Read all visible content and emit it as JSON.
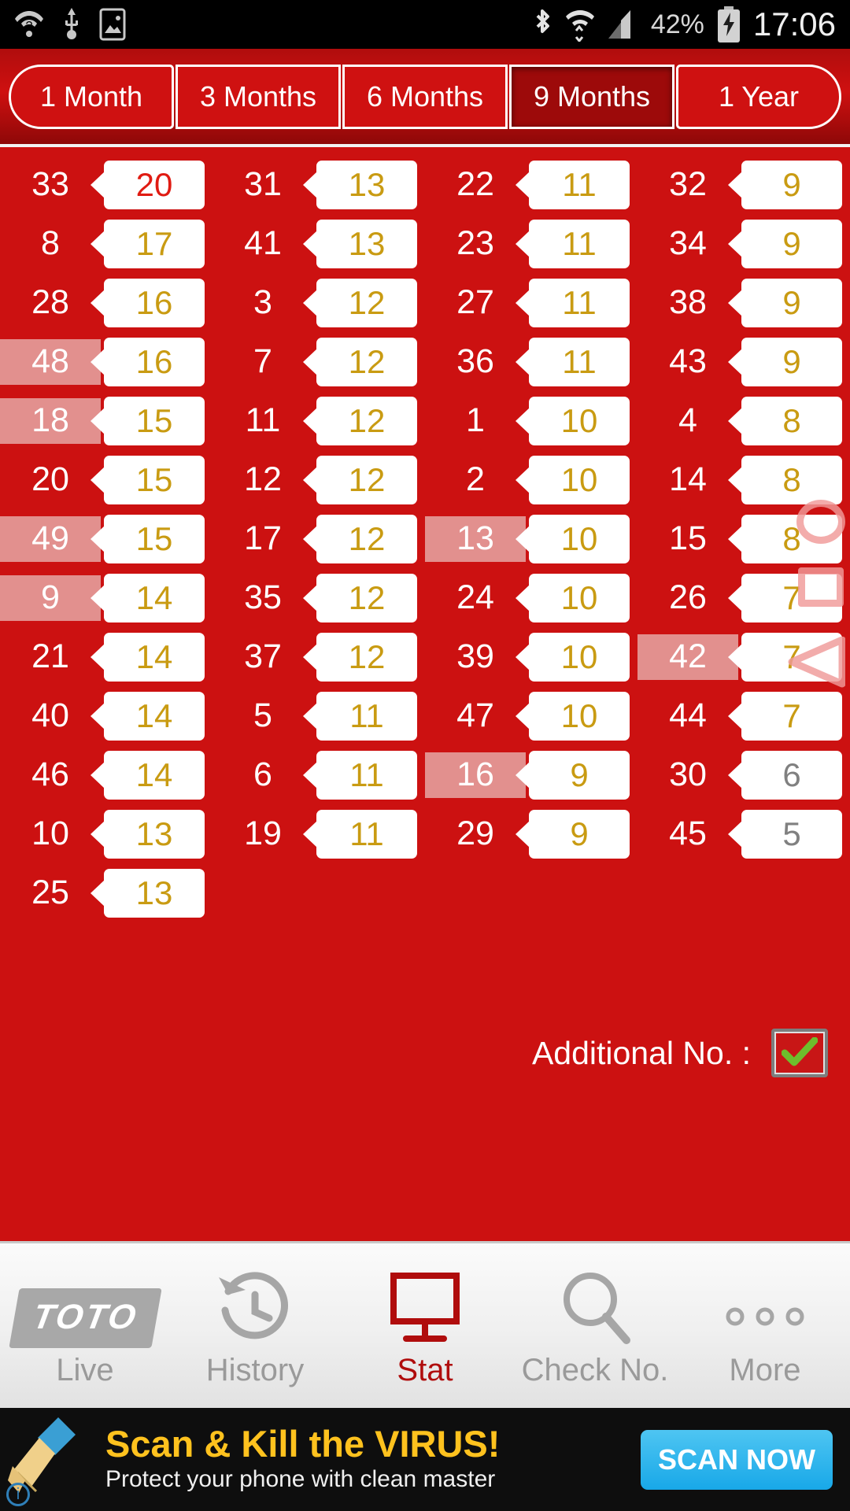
{
  "statusbar": {
    "left_icons": [
      "wifi-question-icon",
      "usb-icon",
      "screenshot-icon"
    ],
    "right_icons": [
      "bluetooth-icon",
      "wifi-icon",
      "signal-icon"
    ],
    "battery_percent": "42%",
    "battery_icon": "battery-charging-icon",
    "clock": "17:06"
  },
  "tabs": [
    {
      "label": "1 Month",
      "selected": false
    },
    {
      "label": "3 Months",
      "selected": false
    },
    {
      "label": "6 Months",
      "selected": false
    },
    {
      "label": "9 Months",
      "selected": true
    },
    {
      "label": "1 Year",
      "selected": false
    }
  ],
  "stats": {
    "columns": [
      {
        "rows": [
          {
            "ball": "33",
            "count": "20",
            "highlighted": false,
            "count_color": "red"
          },
          {
            "ball": "8",
            "count": "17",
            "highlighted": false,
            "count_color": "gold"
          },
          {
            "ball": "28",
            "count": "16",
            "highlighted": false,
            "count_color": "gold"
          },
          {
            "ball": "48",
            "count": "16",
            "highlighted": true,
            "count_color": "gold"
          },
          {
            "ball": "18",
            "count": "15",
            "highlighted": true,
            "count_color": "gold"
          },
          {
            "ball": "20",
            "count": "15",
            "highlighted": false,
            "count_color": "gold"
          },
          {
            "ball": "49",
            "count": "15",
            "highlighted": true,
            "count_color": "gold"
          },
          {
            "ball": "9",
            "count": "14",
            "highlighted": true,
            "count_color": "gold"
          },
          {
            "ball": "21",
            "count": "14",
            "highlighted": false,
            "count_color": "gold"
          },
          {
            "ball": "40",
            "count": "14",
            "highlighted": false,
            "count_color": "gold"
          },
          {
            "ball": "46",
            "count": "14",
            "highlighted": false,
            "count_color": "gold"
          },
          {
            "ball": "10",
            "count": "13",
            "highlighted": false,
            "count_color": "gold"
          },
          {
            "ball": "25",
            "count": "13",
            "highlighted": false,
            "count_color": "gold"
          }
        ]
      },
      {
        "rows": [
          {
            "ball": "31",
            "count": "13",
            "highlighted": false,
            "count_color": "gold"
          },
          {
            "ball": "41",
            "count": "13",
            "highlighted": false,
            "count_color": "gold"
          },
          {
            "ball": "3",
            "count": "12",
            "highlighted": false,
            "count_color": "gold"
          },
          {
            "ball": "7",
            "count": "12",
            "highlighted": false,
            "count_color": "gold"
          },
          {
            "ball": "11",
            "count": "12",
            "highlighted": false,
            "count_color": "gold"
          },
          {
            "ball": "12",
            "count": "12",
            "highlighted": false,
            "count_color": "gold"
          },
          {
            "ball": "17",
            "count": "12",
            "highlighted": false,
            "count_color": "gold"
          },
          {
            "ball": "35",
            "count": "12",
            "highlighted": false,
            "count_color": "gold"
          },
          {
            "ball": "37",
            "count": "12",
            "highlighted": false,
            "count_color": "gold"
          },
          {
            "ball": "5",
            "count": "11",
            "highlighted": false,
            "count_color": "gold"
          },
          {
            "ball": "6",
            "count": "11",
            "highlighted": false,
            "count_color": "gold"
          },
          {
            "ball": "19",
            "count": "11",
            "highlighted": false,
            "count_color": "gold"
          }
        ]
      },
      {
        "rows": [
          {
            "ball": "22",
            "count": "11",
            "highlighted": false,
            "count_color": "gold"
          },
          {
            "ball": "23",
            "count": "11",
            "highlighted": false,
            "count_color": "gold"
          },
          {
            "ball": "27",
            "count": "11",
            "highlighted": false,
            "count_color": "gold"
          },
          {
            "ball": "36",
            "count": "11",
            "highlighted": false,
            "count_color": "gold"
          },
          {
            "ball": "1",
            "count": "10",
            "highlighted": false,
            "count_color": "gold"
          },
          {
            "ball": "2",
            "count": "10",
            "highlighted": false,
            "count_color": "gold"
          },
          {
            "ball": "13",
            "count": "10",
            "highlighted": true,
            "count_color": "gold"
          },
          {
            "ball": "24",
            "count": "10",
            "highlighted": false,
            "count_color": "gold"
          },
          {
            "ball": "39",
            "count": "10",
            "highlighted": false,
            "count_color": "gold"
          },
          {
            "ball": "47",
            "count": "10",
            "highlighted": false,
            "count_color": "gold"
          },
          {
            "ball": "16",
            "count": "9",
            "highlighted": true,
            "count_color": "gold"
          },
          {
            "ball": "29",
            "count": "9",
            "highlighted": false,
            "count_color": "gold"
          }
        ]
      },
      {
        "rows": [
          {
            "ball": "32",
            "count": "9",
            "highlighted": false,
            "count_color": "gold"
          },
          {
            "ball": "34",
            "count": "9",
            "highlighted": false,
            "count_color": "gold"
          },
          {
            "ball": "38",
            "count": "9",
            "highlighted": false,
            "count_color": "gold"
          },
          {
            "ball": "43",
            "count": "9",
            "highlighted": false,
            "count_color": "gold"
          },
          {
            "ball": "4",
            "count": "8",
            "highlighted": false,
            "count_color": "gold"
          },
          {
            "ball": "14",
            "count": "8",
            "highlighted": false,
            "count_color": "gold"
          },
          {
            "ball": "15",
            "count": "8",
            "highlighted": false,
            "count_color": "gold"
          },
          {
            "ball": "26",
            "count": "7",
            "highlighted": false,
            "count_color": "gold"
          },
          {
            "ball": "42",
            "count": "7",
            "highlighted": true,
            "count_color": "gold"
          },
          {
            "ball": "44",
            "count": "7",
            "highlighted": false,
            "count_color": "gold"
          },
          {
            "ball": "30",
            "count": "6",
            "highlighted": false,
            "count_color": "gray"
          },
          {
            "ball": "45",
            "count": "5",
            "highlighted": false,
            "count_color": "gray"
          }
        ]
      }
    ],
    "additional_label": "Additional No. :",
    "additional_checked": true,
    "nav_hints": [
      "circle-hint-icon",
      "square-hint-icon",
      "triangle-hint-icon"
    ]
  },
  "bottomnav": [
    {
      "label": "Live",
      "icon": "toto-logo-icon",
      "active": false
    },
    {
      "label": "History",
      "icon": "clock-back-icon",
      "active": false
    },
    {
      "label": "Stat",
      "icon": "monitor-icon",
      "active": true
    },
    {
      "label": "Check No.",
      "icon": "magnifier-icon",
      "active": false
    },
    {
      "label": "More",
      "icon": "ellipsis-icon",
      "active": false
    }
  ],
  "ad": {
    "title": "Scan & Kill the VIRUS!",
    "subtitle": "Protect your phone with clean master",
    "cta": "SCAN NOW",
    "icon": "broom-icon",
    "info_glyph": "i"
  },
  "colors": {
    "panel_red": "#cc1111",
    "highlight_pink": "#e2908e",
    "count_gold": "#c99b12",
    "count_red": "#e01b12",
    "count_gray": "#808080",
    "accent_blue": "#18a8e8",
    "ad_gold": "#ffc21e"
  }
}
